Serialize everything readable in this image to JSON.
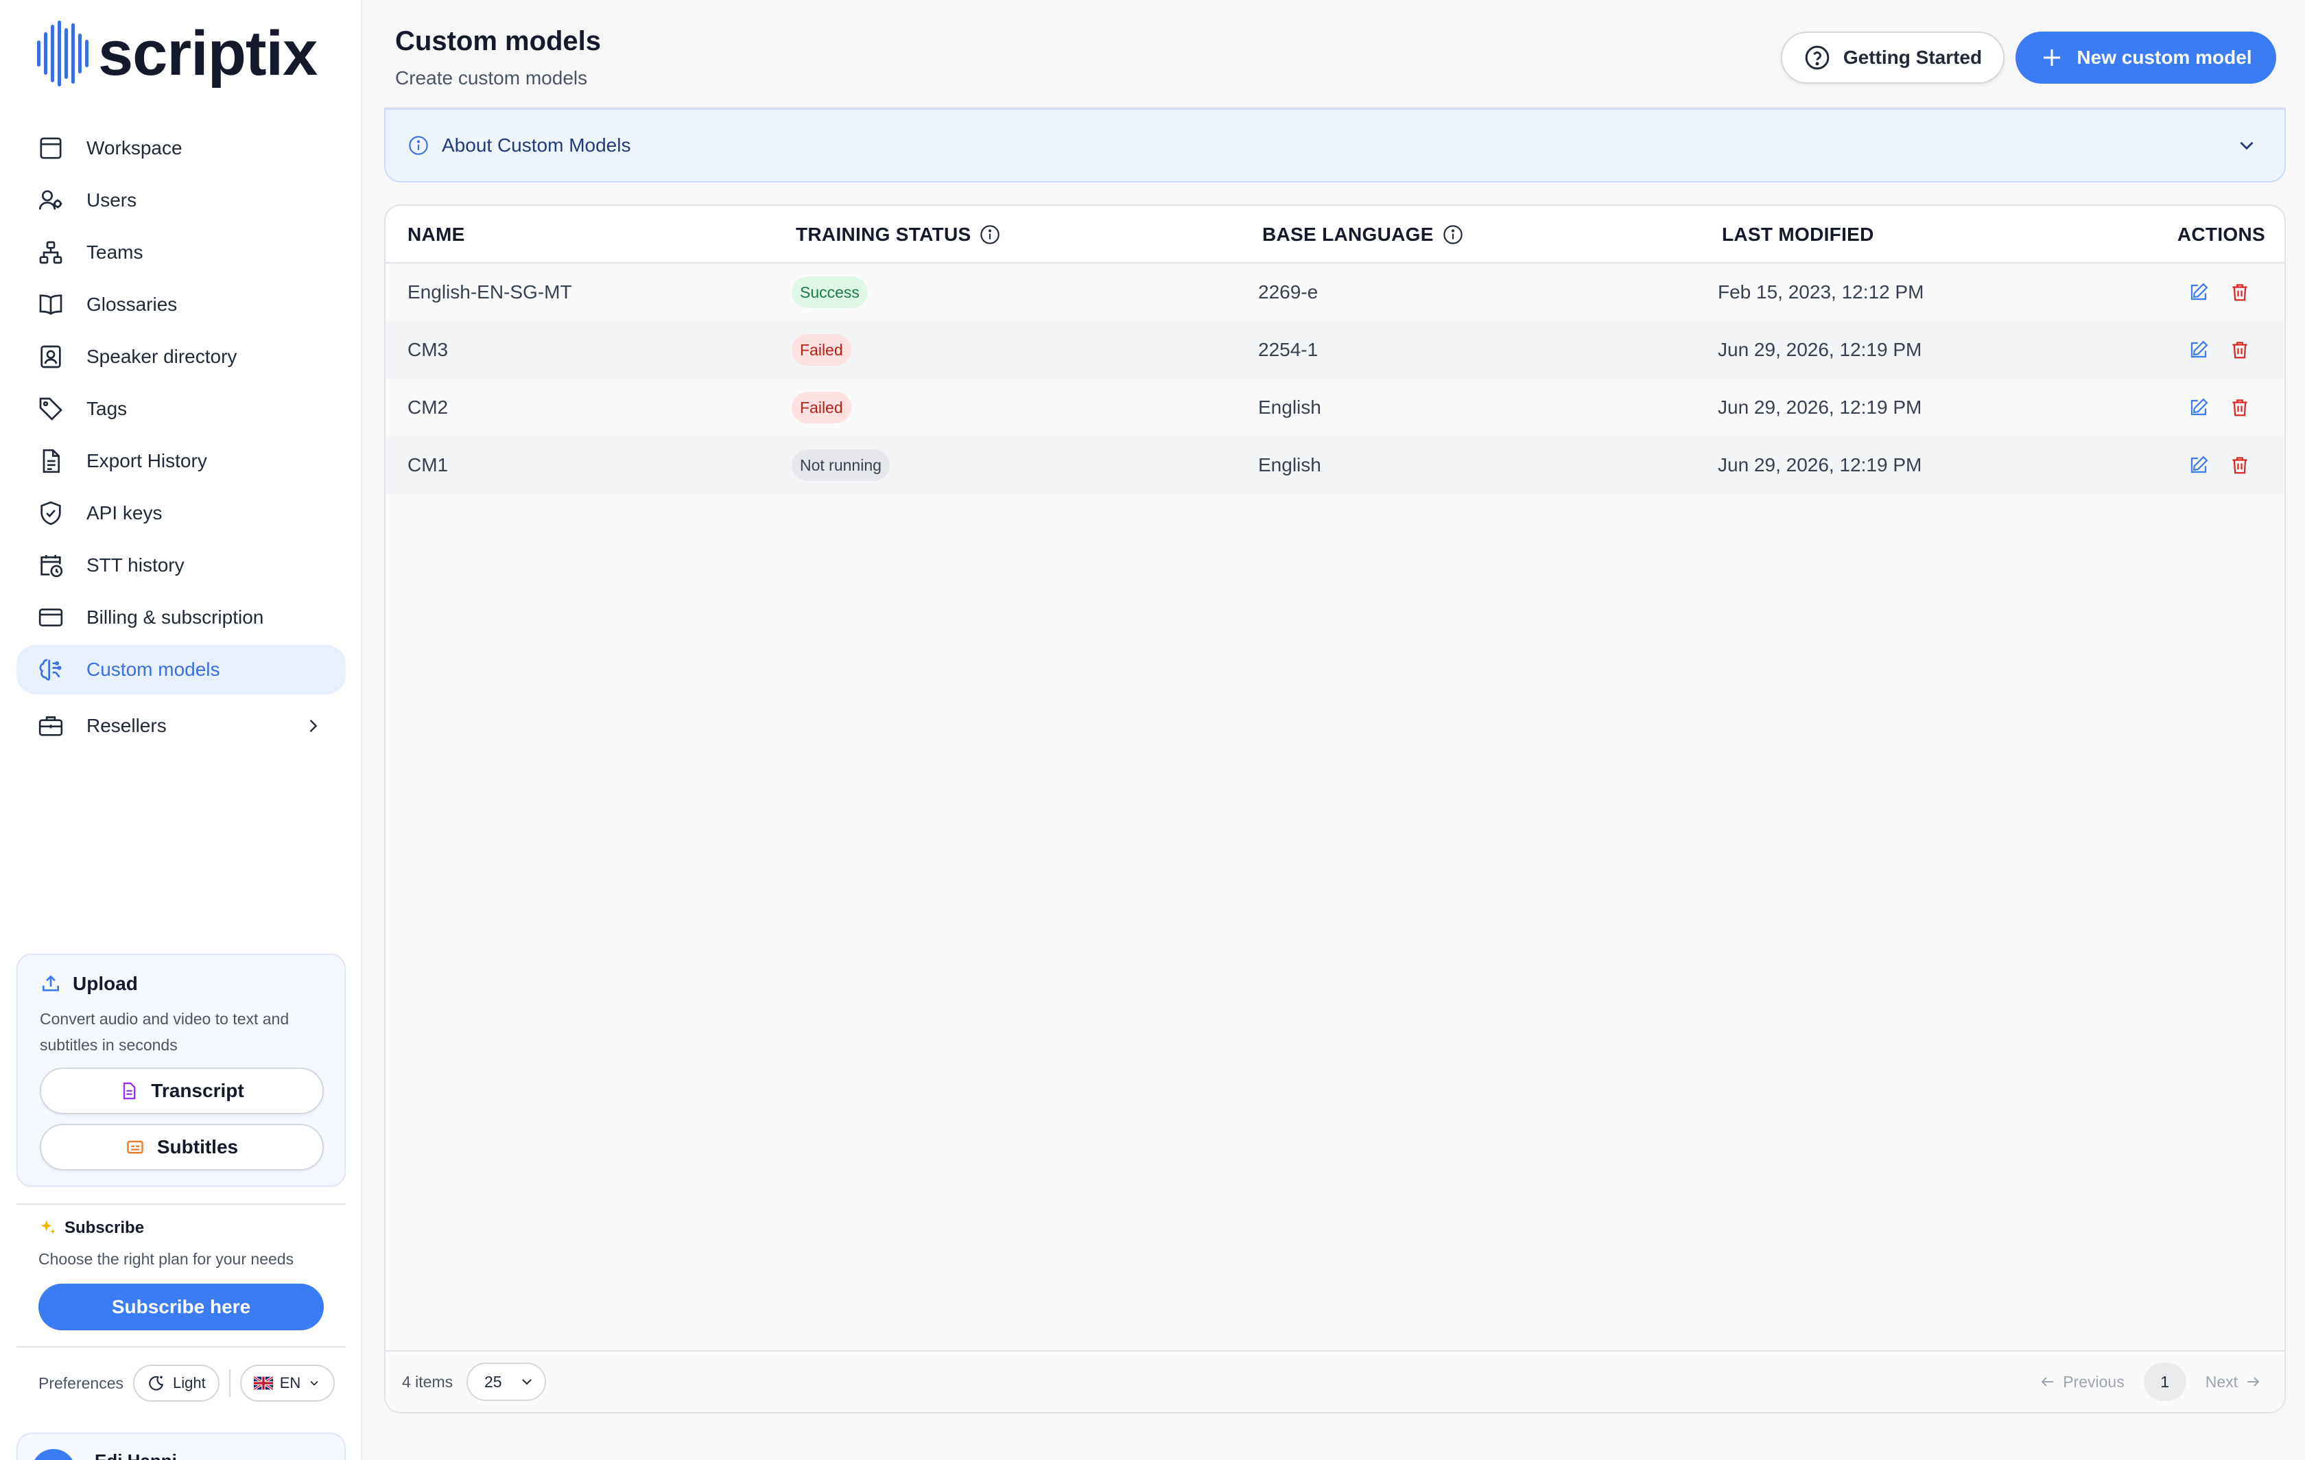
{
  "brand": {
    "name": "scriptix",
    "accent": "#3b7cf4"
  },
  "sidebar": {
    "items": [
      {
        "label": "Workspace",
        "icon": "layout-icon"
      },
      {
        "label": "Users",
        "icon": "users-icon"
      },
      {
        "label": "Teams",
        "icon": "hierarchy-icon"
      },
      {
        "label": "Glossaries",
        "icon": "book-icon"
      },
      {
        "label": "Speaker directory",
        "icon": "contact-book-icon"
      },
      {
        "label": "Tags",
        "icon": "tag-icon"
      },
      {
        "label": "Export History",
        "icon": "document-icon"
      },
      {
        "label": "API keys",
        "icon": "shield-check-icon"
      },
      {
        "label": "STT history",
        "icon": "calendar-clock-icon"
      },
      {
        "label": "Billing & subscription",
        "icon": "credit-card-icon"
      },
      {
        "label": "Custom models",
        "icon": "brain-icon",
        "active": true
      },
      {
        "label": "Resellers",
        "icon": "briefcase-icon",
        "has_submenu": true
      }
    ],
    "upload": {
      "title": "Upload",
      "description": "Convert audio and video to text and subtitles in seconds",
      "transcript_label": "Transcript",
      "subtitles_label": "Subtitles"
    },
    "subscribe": {
      "title": "Subscribe",
      "description": "Choose the right plan for your needs",
      "button_label": "Subscribe here"
    },
    "preferences": {
      "label": "Preferences",
      "theme": "Light",
      "language": "EN"
    },
    "user": {
      "name": "Edi Hanni"
    }
  },
  "header": {
    "title": "Custom models",
    "subtitle": "Create custom models",
    "getting_started_label": "Getting Started",
    "new_model_label": "New custom model"
  },
  "accordion": {
    "label": "About Custom Models"
  },
  "table": {
    "columns": {
      "name": "NAME",
      "status": "TRAINING STATUS",
      "language": "BASE LANGUAGE",
      "modified": "LAST MODIFIED",
      "actions": "ACTIONS"
    },
    "rows": [
      {
        "name": "English-EN-SG-MT",
        "status": "Success",
        "status_kind": "success",
        "language": "2269-e",
        "modified": "Feb 15, 2023, 12:12 PM"
      },
      {
        "name": "CM3",
        "status": "Failed",
        "status_kind": "failed",
        "language": "2254-1",
        "modified": "Jun 29, 2026, 12:19 PM"
      },
      {
        "name": "CM2",
        "status": "Failed",
        "status_kind": "failed",
        "language": "English",
        "modified": "Jun 29, 2026, 12:19 PM"
      },
      {
        "name": "CM1",
        "status": "Not running",
        "status_kind": "idle",
        "language": "English",
        "modified": "Jun 29, 2026, 12:19 PM"
      }
    ],
    "footer": {
      "items_count": "4 items",
      "page_size": "25",
      "previous_label": "Previous",
      "next_label": "Next",
      "current_page": "1"
    }
  }
}
